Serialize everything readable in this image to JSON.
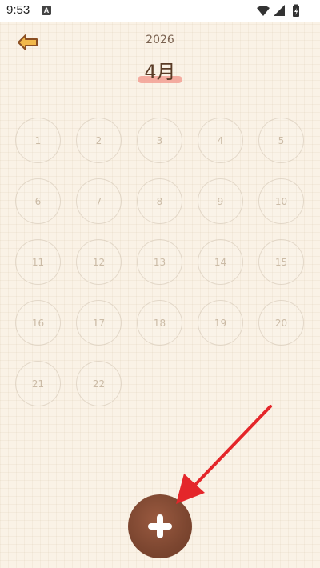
{
  "status_bar": {
    "time": "9:53",
    "notification_icon": "A"
  },
  "header": {
    "year": "2026",
    "month": "4月"
  },
  "calendar": {
    "days": [
      "1",
      "2",
      "3",
      "4",
      "5",
      "6",
      "7",
      "8",
      "9",
      "10",
      "11",
      "12",
      "13",
      "14",
      "15",
      "16",
      "17",
      "18",
      "19",
      "20",
      "21",
      "22"
    ]
  },
  "icons": {
    "back": "back-arrow-icon",
    "add": "plus-icon",
    "wifi": "wifi-icon",
    "signal": "signal-icon",
    "battery": "battery-icon"
  },
  "colors": {
    "background": "#faf2e6",
    "accent_brown": "#7c4630",
    "underline": "#f29a8e",
    "back_arrow": "#e6a33c",
    "annotation_arrow": "#e4262a"
  }
}
